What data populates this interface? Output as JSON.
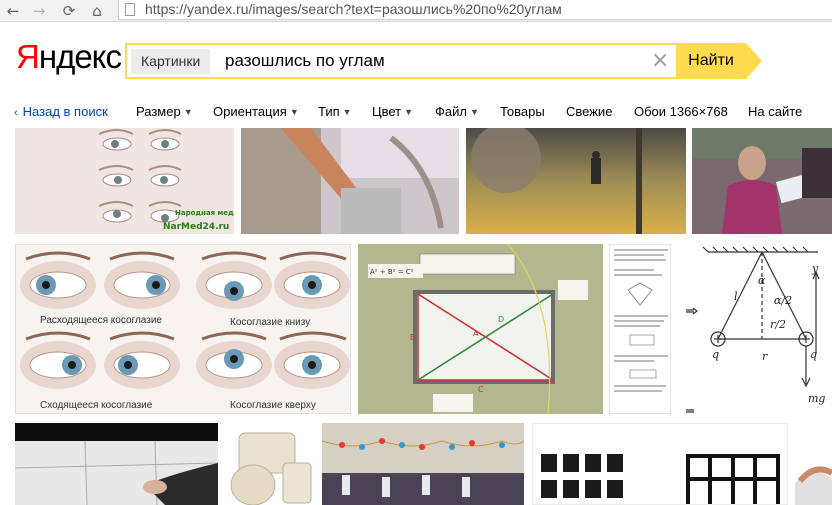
{
  "browser": {
    "back_icon": "arrow-left-icon",
    "forward_icon": "arrow-right-icon",
    "reload_icon": "reload-icon",
    "home_icon": "home-icon",
    "url": "https://yandex.ru/images/search?text=разошлись%20по%20углам"
  },
  "header": {
    "logo_y": "Я",
    "logo_rest": "ндекс",
    "search_tag": "Картинки",
    "search_value": "разошлись по углам",
    "clear_icon": "×",
    "find_label": "Найти"
  },
  "filters": {
    "back": "Назад в поиск",
    "items": [
      "Размер",
      "Ориентация",
      "Тип",
      "Цвет",
      "Файл"
    ],
    "extra": [
      "Товары",
      "Свежие",
      "Обои 1366×768",
      "На сайте"
    ]
  },
  "images": {
    "eyes_small_watermark": "Народная медицина",
    "eyes_small_site": "NarMed24.ru",
    "strabismus_labels": [
      "Расходящееся косоглазие",
      "Косоглазие книзу",
      "Сходящееся косоглазие",
      "Косоглазие кверху"
    ],
    "triangle_labels": [
      "A",
      "B",
      "C",
      "D"
    ],
    "formula": "A² + B² = C²",
    "physics_labels": [
      "y",
      "α",
      "l",
      "α/2",
      "r/2",
      "r",
      "q",
      "q",
      "mg"
    ]
  },
  "colors": {
    "accent_yellow": "#ffdb4d",
    "link_blue": "#0044bb",
    "logo_red": "#ff0000"
  }
}
